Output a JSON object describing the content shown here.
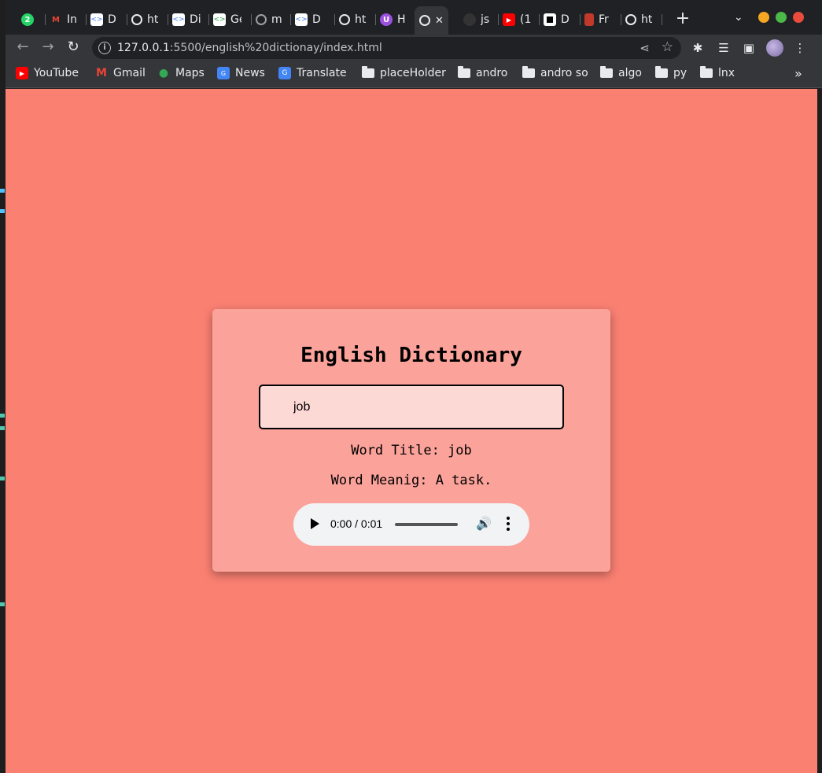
{
  "browser": {
    "tabs": [
      {
        "title": "",
        "icon": "whatsapp-icon",
        "color": "#25d366"
      },
      {
        "title": "In",
        "icon": "gmail-icon",
        "color": "#ea4335"
      },
      {
        "title": "D",
        "icon": "code-icon",
        "color": "#ffffff"
      },
      {
        "title": "ht",
        "icon": "globe-icon",
        "color": "#e8eaed"
      },
      {
        "title": "Di",
        "icon": "code-icon",
        "color": "#ffffff"
      },
      {
        "title": "Ge",
        "icon": "code-icon",
        "color": "#ffffff"
      },
      {
        "title": "m",
        "icon": "globe-icon",
        "color": "#9aa0a6"
      },
      {
        "title": "D",
        "icon": "code-icon",
        "color": "#ffffff"
      },
      {
        "title": "ht",
        "icon": "globe-icon",
        "color": "#e8eaed"
      },
      {
        "title": "H",
        "icon": "extension-icon",
        "color": "#9b51e0"
      },
      {
        "title": "",
        "icon": "globe-icon",
        "color": "#e8eaed",
        "active": true
      },
      {
        "title": "js",
        "icon": "github-icon",
        "color": "#333333"
      },
      {
        "title": "(1",
        "icon": "youtube-icon",
        "color": "#ff0000"
      },
      {
        "title": "D",
        "icon": "app-icon",
        "color": "#000000"
      },
      {
        "title": "Fr",
        "icon": "book-icon",
        "color": "#c0392b"
      },
      {
        "title": "ht",
        "icon": "globe-icon",
        "color": "#e8eaed"
      }
    ],
    "whatsapp_badge": "2",
    "close_tab": "✕",
    "url_host": "127.0.0.1",
    "url_rest": ":5500/english%20dictionay/index.html",
    "bookmarks": [
      {
        "label": "YouTube",
        "icon": "youtube-icon"
      },
      {
        "label": "Gmail",
        "icon": "gmail-icon"
      },
      {
        "label": "Maps",
        "icon": "maps-icon"
      },
      {
        "label": "News",
        "icon": "news-icon"
      },
      {
        "label": "Translate",
        "icon": "translate-icon"
      },
      {
        "label": "placeHolder",
        "icon": "folder-icon"
      },
      {
        "label": "andro",
        "icon": "folder-icon"
      },
      {
        "label": "andro so",
        "icon": "folder-icon"
      },
      {
        "label": "algo",
        "icon": "folder-icon"
      },
      {
        "label": "py",
        "icon": "folder-icon"
      },
      {
        "label": "lnx",
        "icon": "folder-icon"
      }
    ],
    "bookmarks_overflow": "»"
  },
  "page": {
    "background": "#fa8072",
    "card_background": "#fba29a",
    "heading": "English Dictionary",
    "search_value": "job",
    "title_label": "Word Title:",
    "title_value": "job",
    "meaning_label": "Word Meanig:",
    "meaning_value": "A task.",
    "audio_time": "0:00 / 0:01"
  }
}
